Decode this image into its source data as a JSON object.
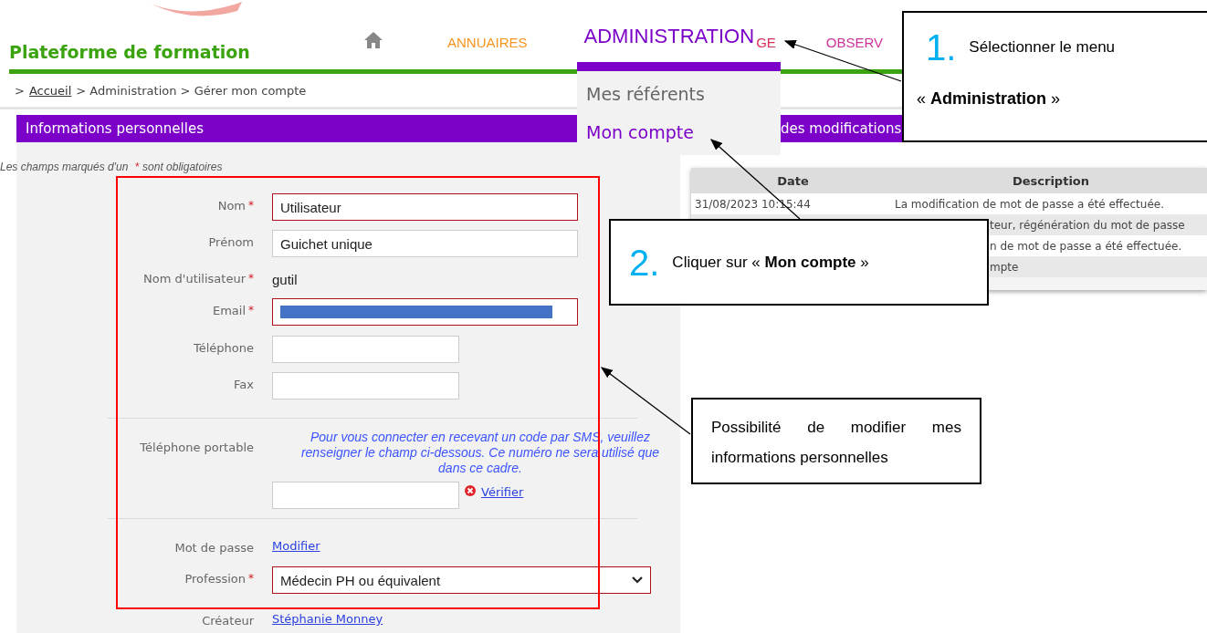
{
  "header": {
    "title": "Plateforme de formation",
    "nav": [
      {
        "label": "ANNUAIRES",
        "color": "#f7941d",
        "selected": false
      },
      {
        "label": "ADMINISTRATION",
        "color": "#7b00c8",
        "selected": true
      },
      {
        "label": "GE",
        "color": "#d9305a",
        "selected": false
      },
      {
        "label": "OBSERV",
        "color": "#cc3399",
        "selected": false
      }
    ]
  },
  "breadcrumb": {
    "prefix": ">",
    "link": "Accueil",
    "trail": "> Administration > Gérer mon compte"
  },
  "dropdown": [
    {
      "label": "Mes référents",
      "selected": false
    },
    {
      "label": "Mon compte",
      "selected": true
    }
  ],
  "panel": {
    "title": "Informations personnelles",
    "note": "Les champs marqués d'un",
    "note_star": "*",
    "note_end": "sont obligatoires"
  },
  "form": [
    {
      "kind": "input",
      "label": "Nom",
      "required": true,
      "value": "Utilisateur",
      "wide": true
    },
    {
      "kind": "input",
      "label": "Prénom",
      "required": false,
      "value": "Guichet unique",
      "wide": true
    },
    {
      "kind": "text",
      "label": "Nom d'utilisateur",
      "required": true,
      "value": "gutil"
    },
    {
      "kind": "redacted",
      "label": "Email",
      "required": true
    },
    {
      "kind": "input",
      "label": "Téléphone",
      "required": false,
      "wide": false
    },
    {
      "kind": "input",
      "label": "Fax",
      "required": false,
      "wide": false
    },
    {
      "kind": "mobile",
      "label": "Téléphone portable",
      "help": "Pour vous connecter en recevant un code par SMS, veuillez renseigner le champ ci-dessous. Ce numéro ne sera utilisé que dans ce cadre.",
      "link": "Vérifier"
    },
    {
      "kind": "link",
      "label": "Mot de passe",
      "value": "Modifier"
    },
    {
      "kind": "select",
      "label": "Profession",
      "required": true,
      "value": "Médecin PH ou équivalent"
    },
    {
      "kind": "link",
      "label": "Créateur",
      "value": "Stéphanie Monney"
    }
  ],
  "history": {
    "title": "des modifications",
    "columns": [
      "Date",
      "Description"
    ],
    "rows": [
      {
        "date": "31/08/2023 10:15:44",
        "description": "La modification de mot de passe a été effectuée."
      },
      {
        "description": "teur, régénération du mot de passe"
      },
      {
        "description": "n de mot de passe a été effectuée."
      },
      {
        "description": "mpte"
      }
    ]
  },
  "callouts": [
    {
      "number": "1.",
      "text": "Sélectionner le menu",
      "text2": "« **Administration** »"
    },
    {
      "number": "2.",
      "text": "Cliquer sur « **Mon compte** »"
    },
    {
      "text": "Possibilité de modifier mes informations personnelles"
    }
  ]
}
